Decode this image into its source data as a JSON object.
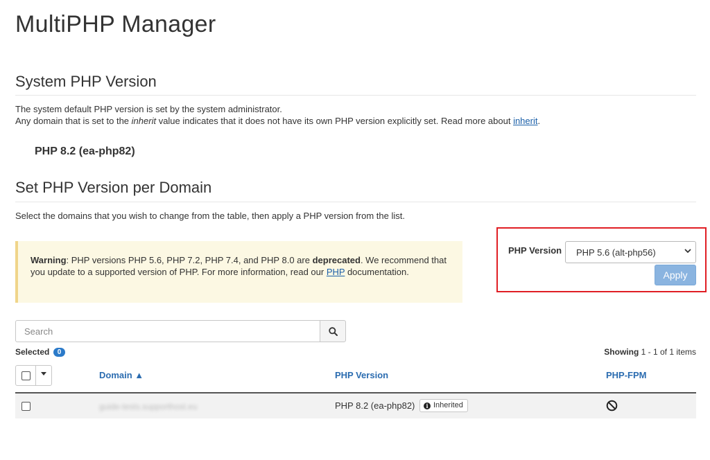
{
  "page_title": "MultiPHP Manager",
  "system_section": {
    "heading": "System PHP Version",
    "line1": "The system default PHP version is set by the system administrator.",
    "line2_pre": "Any domain that is set to the ",
    "line2_em": "inherit",
    "line2_post": " value indicates that it does not have its own PHP version explicitly set. Read more about ",
    "line2_link": "inherit",
    "line2_end": ".",
    "current_version": "PHP 8.2 (ea-php82)"
  },
  "domain_section": {
    "heading": "Set PHP Version per Domain",
    "description": "Select the domains that you wish to change from the table, then apply a PHP version from the list."
  },
  "warning": {
    "label": "Warning",
    "text1": ": PHP versions PHP 5.6, PHP 7.2, PHP 7.4, and PHP 8.0 are ",
    "bold": "deprecated",
    "text2": ". We recommend that you update to a supported version of PHP. For more information, read our ",
    "link": "PHP",
    "text3": " documentation."
  },
  "version_picker": {
    "label": "PHP Version",
    "selected": "PHP 5.6 (alt-php56)",
    "apply_label": "Apply",
    "highlight_color": "#e01e24"
  },
  "search": {
    "placeholder": "Search",
    "icon": "search-icon"
  },
  "selection": {
    "label": "Selected",
    "count": "0"
  },
  "pagination": {
    "prefix": "Showing",
    "range": "1 - 1 of 1 items"
  },
  "table": {
    "columns": {
      "domain": "Domain ▲",
      "php_version": "PHP Version",
      "php_fpm": "PHP-FPM"
    },
    "rows": [
      {
        "domain": "guide-tests.supporthost.eu",
        "php_version": "PHP 8.2 (ea-php82)",
        "badge": "Inherited",
        "fpm_icon": "disabled-icon"
      }
    ]
  }
}
